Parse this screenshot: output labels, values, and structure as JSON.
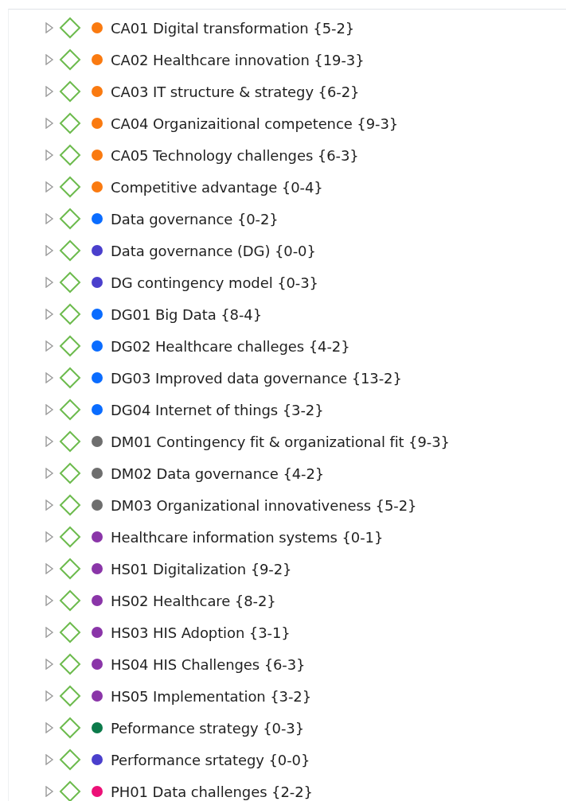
{
  "tree": {
    "items": [
      {
        "label": "CA01 Digital transformation {5-2}",
        "color": "#fa7a10",
        "expanded": false
      },
      {
        "label": "CA02 Healthcare innovation {19-3}",
        "color": "#fa7a10",
        "expanded": false
      },
      {
        "label": "CA03 IT structure & strategy {6-2}",
        "color": "#fa7a10",
        "expanded": false
      },
      {
        "label": "CA04 Organizaitional competence {9-3}",
        "color": "#fa7a10",
        "expanded": false
      },
      {
        "label": "CA05 Technology challenges {6-3}",
        "color": "#fa7a10",
        "expanded": false
      },
      {
        "label": "Competitive advantage {0-4}",
        "color": "#fa7a10",
        "expanded": false
      },
      {
        "label": "Data governance {0-2}",
        "color": "#0a6cff",
        "expanded": false
      },
      {
        "label": "Data governance (DG) {0-0}",
        "color": "#4a3fcc",
        "expanded": false
      },
      {
        "label": "DG contingency model {0-3}",
        "color": "#4a3fcc",
        "expanded": false
      },
      {
        "label": "DG01 Big Data {8-4}",
        "color": "#0a6cff",
        "expanded": false
      },
      {
        "label": "DG02 Healthcare challeges {4-2}",
        "color": "#0a6cff",
        "expanded": false
      },
      {
        "label": "DG03 Improved data governance {13-2}",
        "color": "#0a6cff",
        "expanded": false
      },
      {
        "label": "DG04 Internet of things {3-2}",
        "color": "#0a6cff",
        "expanded": false
      },
      {
        "label": "DM01 Contingency fit & organizational fit {9-3}",
        "color": "#6e6e6e",
        "expanded": false
      },
      {
        "label": "DM02 Data governance {4-2}",
        "color": "#6e6e6e",
        "expanded": false
      },
      {
        "label": "DM03 Organizational innovativeness {5-2}",
        "color": "#6e6e6e",
        "expanded": false
      },
      {
        "label": "Healthcare information systems {0-1}",
        "color": "#8a35a8",
        "expanded": false
      },
      {
        "label": "HS01 Digitalization {9-2}",
        "color": "#8a35a8",
        "expanded": false
      },
      {
        "label": "HS02 Healthcare {8-2}",
        "color": "#8a35a8",
        "expanded": false
      },
      {
        "label": "HS03 HIS Adoption {3-1}",
        "color": "#8a35a8",
        "expanded": false
      },
      {
        "label": "HS04 HIS Challenges {6-3}",
        "color": "#8a35a8",
        "expanded": false
      },
      {
        "label": "HS05 Implementation {3-2}",
        "color": "#8a35a8",
        "expanded": false
      },
      {
        "label": "Peformance strategy {0-3}",
        "color": "#0b7a4a",
        "expanded": false
      },
      {
        "label": "Performance srtategy {0-0}",
        "color": "#4a3fcc",
        "expanded": false
      },
      {
        "label": "PH01 Data challenges {2-2}",
        "color": "#ec1077",
        "expanded": false
      }
    ]
  }
}
